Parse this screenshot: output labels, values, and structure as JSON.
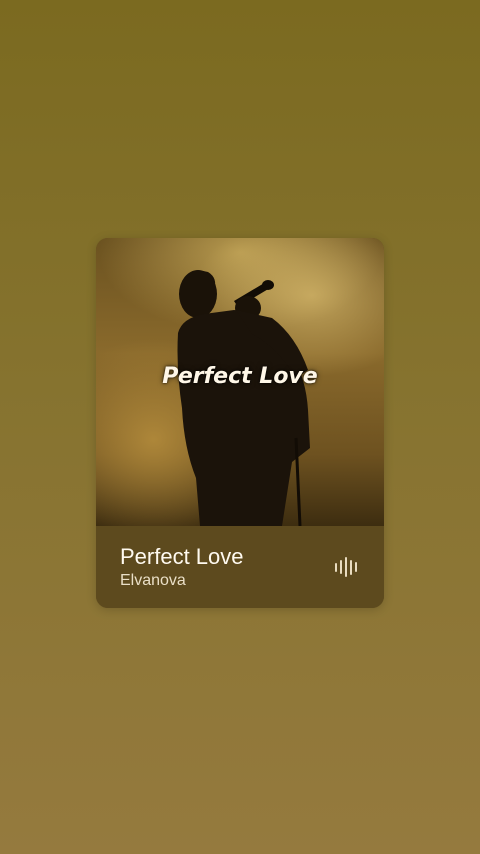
{
  "now_playing": {
    "artwork_text": "Perfect Love",
    "title": "Perfect Love",
    "artist": "Elvanova",
    "visualizer_icon": "audio-bars-icon"
  },
  "colors": {
    "background_top": "#7b6a20",
    "background_bottom": "#957a3e",
    "card_info": "#5d4a1e",
    "title_text": "#fffaf0",
    "artist_text": "#eadfc7"
  }
}
